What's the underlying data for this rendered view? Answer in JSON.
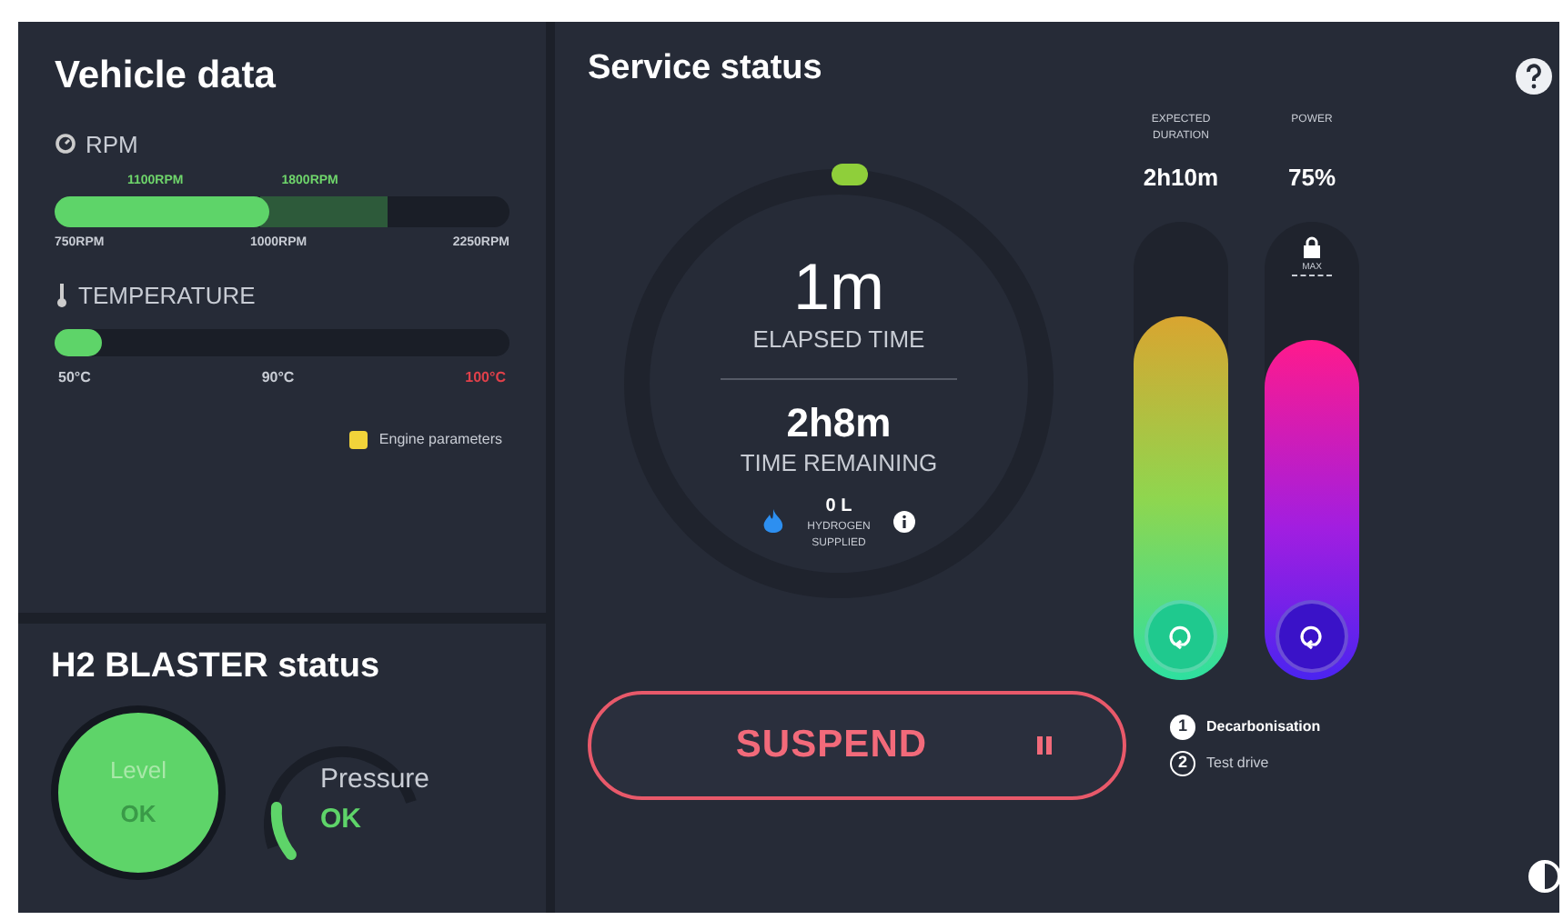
{
  "vehicle_data": {
    "title": "Vehicle data",
    "rpm": {
      "label": "RPM",
      "level": 0.47,
      "markers": [
        "1100RPM",
        "1800RPM"
      ],
      "ticks": [
        "750RPM",
        "1000RPM",
        "2250RPM"
      ]
    },
    "temperature": {
      "label": "TEMPERATURE",
      "level": 0.06,
      "ticks": [
        {
          "label": "50°C",
          "warning": false
        },
        {
          "label": "90°C",
          "warning": false
        },
        {
          "label": "100°C",
          "warning": true
        }
      ]
    },
    "legend": "Engine parameters"
  },
  "blaster": {
    "title": "H2 BLASTER status",
    "gauges": [
      {
        "kind": "circle",
        "label": "Level",
        "value": "OK"
      },
      {
        "kind": "arc",
        "label": "Pressure",
        "value": "OK"
      }
    ]
  },
  "service": {
    "title": "Service status",
    "elapsed": "1m",
    "elapsed_label": "ELAPSED TIME",
    "remaining": "2h8m",
    "remaining_label": "TIME REMAINING",
    "hydrogen": "0 L",
    "hydrogen_label": "HYDROGEN SUPPLIED",
    "sliders": [
      {
        "label": "EXPECTED DURATION",
        "value": "2h10m",
        "locked": false
      },
      {
        "label": "POWER",
        "value": "75%",
        "locked": true,
        "lock_label": "MAX"
      }
    ],
    "button": "SUSPEND",
    "steps": [
      {
        "number": "1",
        "label": "Decarbonisation",
        "selected": true
      },
      {
        "number": "2",
        "label": "Test drive",
        "selected": false
      }
    ]
  }
}
